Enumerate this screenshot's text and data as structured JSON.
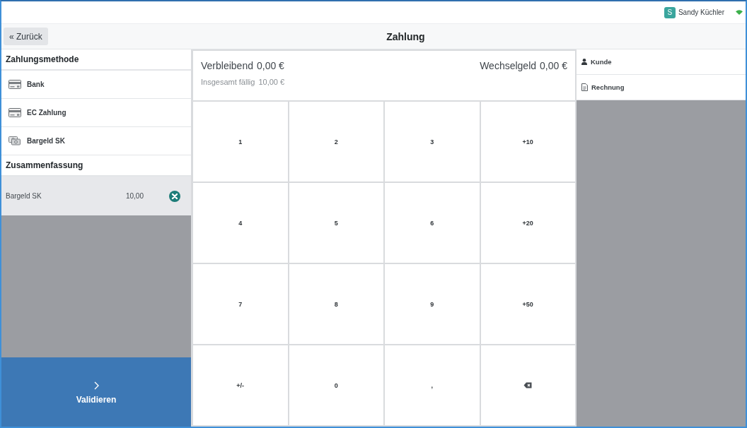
{
  "top_bar": {
    "user": {
      "initial": "S",
      "name": "Sandy Küchler"
    }
  },
  "header": {
    "back_button": "« Zurück",
    "title": "Zahlung"
  },
  "payment_methods": {
    "title": "Zahlungsmethode",
    "items": [
      {
        "kind": "card",
        "label": "Bank"
      },
      {
        "kind": "card",
        "label": "EC Zahlung"
      },
      {
        "kind": "cash",
        "label": "Bargeld SK"
      }
    ]
  },
  "summary": {
    "title": "Zusammenfassung",
    "lines": [
      {
        "method": "Bargeld SK",
        "amount": "10,00"
      }
    ]
  },
  "validate_button": "Validieren",
  "balance": {
    "remaining": {
      "label": "Verbleibend",
      "value": "0,00 €"
    },
    "change": {
      "label": "Wechselgeld",
      "value": "0,00 €"
    },
    "total_due": {
      "label": "Insgesamt fällig",
      "value": "10,00 €"
    }
  },
  "numpad": [
    {
      "kind": "text",
      "label": "1"
    },
    {
      "kind": "text",
      "label": "2"
    },
    {
      "kind": "text",
      "label": "3"
    },
    {
      "kind": "text",
      "label": "+10"
    },
    {
      "kind": "text",
      "label": "4"
    },
    {
      "kind": "text",
      "label": "5"
    },
    {
      "kind": "text",
      "label": "6"
    },
    {
      "kind": "text",
      "label": "+20"
    },
    {
      "kind": "text",
      "label": "7"
    },
    {
      "kind": "text",
      "label": "8"
    },
    {
      "kind": "text",
      "label": "9"
    },
    {
      "kind": "text",
      "label": "+50"
    },
    {
      "kind": "text",
      "label": "+/-"
    },
    {
      "kind": "text",
      "label": "0"
    },
    {
      "kind": "text",
      "label": ","
    },
    {
      "kind": "backspace"
    }
  ],
  "side_actions": [
    {
      "kind": "customer",
      "label": "Kunde"
    },
    {
      "kind": "invoice",
      "label": "Rechnung"
    }
  ]
}
